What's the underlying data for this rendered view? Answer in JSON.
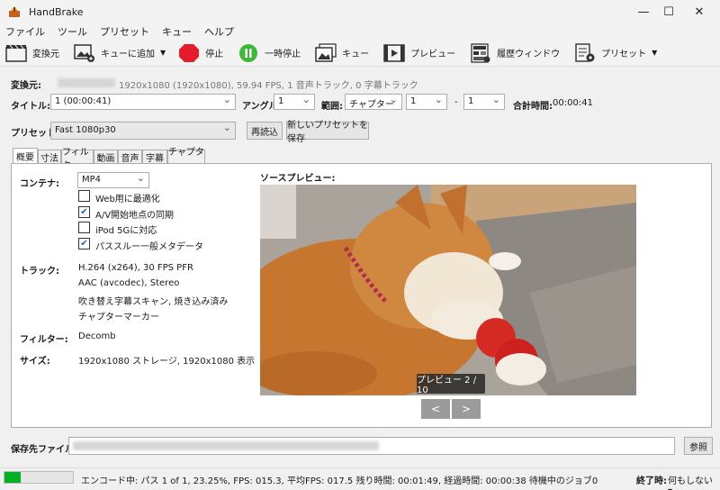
{
  "window": {
    "title": "HandBrake",
    "minimize": "—",
    "maximize": "☐",
    "close": "✕"
  },
  "menu": [
    "ファイル",
    "ツール",
    "プリセット",
    "キュー",
    "ヘルプ"
  ],
  "toolbar": {
    "source": "変換元",
    "add_queue": "キューに追加",
    "stop": "停止",
    "pause": "一時停止",
    "queue": "キュー",
    "preview": "プレビュー",
    "activity": "履歴ウィンドウ",
    "presets": "プリセット"
  },
  "source": {
    "label": "変換元:",
    "info": "1920x1080 (1920x1080), 59.94 FPS, 1 音声トラック, 0 字幕トラック"
  },
  "title_row": {
    "title_label": "タイトル:",
    "title_value": "1 (00:00:41)",
    "angle_label": "アングル:",
    "angle_value": "1",
    "range_label": "範囲:",
    "range_type": "チャプター",
    "range_from": "1",
    "range_dash": "-",
    "range_to": "1",
    "duration_label": "合計時間:",
    "duration_value": "00:00:41"
  },
  "preset_row": {
    "label": "プリセット:",
    "value": "Fast 1080p30",
    "reload": "再読込",
    "save_new": "新しいプリセットを保存"
  },
  "tabs": [
    "概要",
    "寸法",
    "フィルタ",
    "動画",
    "音声",
    "字幕",
    "チャプター"
  ],
  "summary": {
    "container_label": "コンテナ:",
    "container_value": "MP4",
    "options": [
      {
        "label": "Web用に最適化",
        "checked": false
      },
      {
        "label": "A/V開始地点の同期",
        "checked": true
      },
      {
        "label": "iPod 5Gに対応",
        "checked": false
      },
      {
        "label": "パススルー一般メタデータ",
        "checked": true
      }
    ],
    "tracks_label": "トラック:",
    "tracks": [
      "H.264 (x264), 30 FPS PFR",
      "AAC (avcodec), Stereo",
      "吹き替え字幕スキャン, 焼き込み済み",
      "チャプターマーカー"
    ],
    "filters_label": "フィルター:",
    "filters_value": "Decomb",
    "size_label": "サイズ:",
    "size_value": "1920x1080 ストレージ, 1920x1080 表示",
    "preview_label": "ソースプレビュー:",
    "preview_counter": "プレビュー 2 / 10",
    "prev_btn": "<",
    "next_btn": ">"
  },
  "save": {
    "label": "保存先ファイル:",
    "browse": "参照"
  },
  "status": {
    "progress": 0.2325,
    "text": "エンコード中: パス 1 of 1,  23.25%, FPS: 015.3,  平均FPS: 017.5 残り時間: 00:01:49,  経過時間: 00:00:38   待機中のジョブ0",
    "when_done_label": "終了時:",
    "when_done_value": "何もしない"
  },
  "colors": {
    "stop": "#e41b2b",
    "pause": "#3fb83a",
    "progress": "#06b025"
  }
}
